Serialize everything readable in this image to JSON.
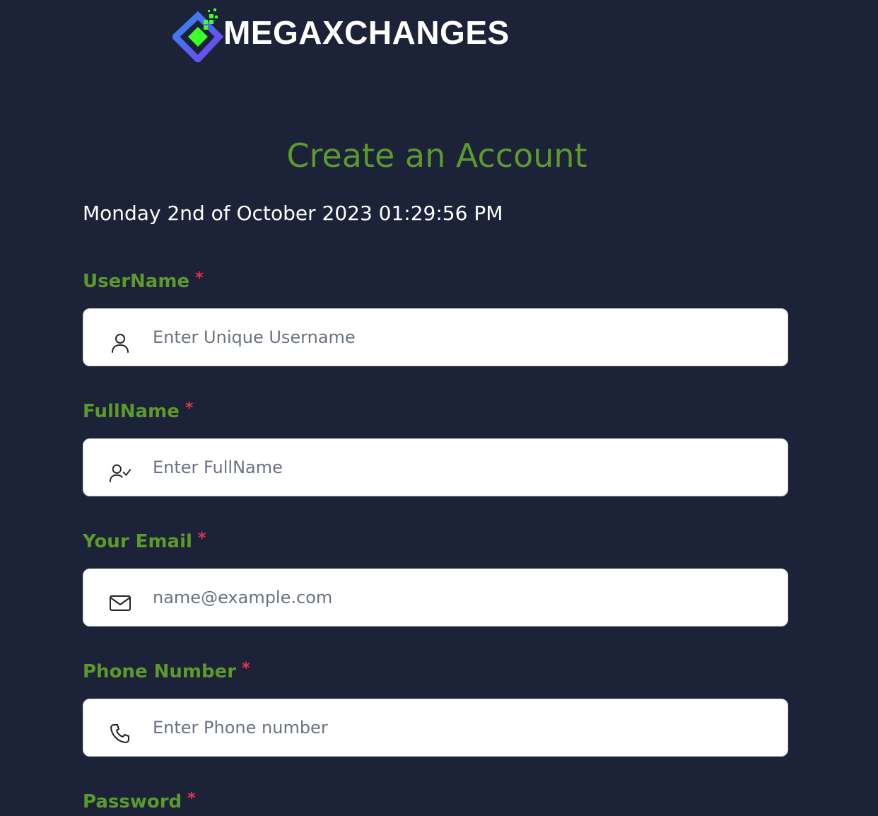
{
  "brand": {
    "name": "MEGAXCHANGES",
    "colors": {
      "diamond_outer": "#6a3ff0",
      "diamond_inner": "#2f8cf0",
      "accent_green": "#3cff2c"
    }
  },
  "page": {
    "title": "Create an Account",
    "datetime": "Monday 2nd of October 2023 01:29:56 PM"
  },
  "form": {
    "fields": [
      {
        "label": "UserName",
        "required_mark": "*",
        "placeholder": "Enter Unique Username",
        "icon": "user-icon"
      },
      {
        "label": "FullName",
        "required_mark": "*",
        "placeholder": "Enter FullName",
        "icon": "user-check-icon"
      },
      {
        "label": "Your Email",
        "required_mark": "*",
        "placeholder": "name@example.com",
        "icon": "mail-icon"
      },
      {
        "label": "Phone Number",
        "required_mark": "*",
        "placeholder": "Enter Phone number",
        "icon": "phone-icon"
      },
      {
        "label": "Password",
        "required_mark": "*"
      }
    ]
  },
  "theme": {
    "background": "#1c2237",
    "label_color": "#5b9a2b",
    "required_color": "#e0344f"
  }
}
